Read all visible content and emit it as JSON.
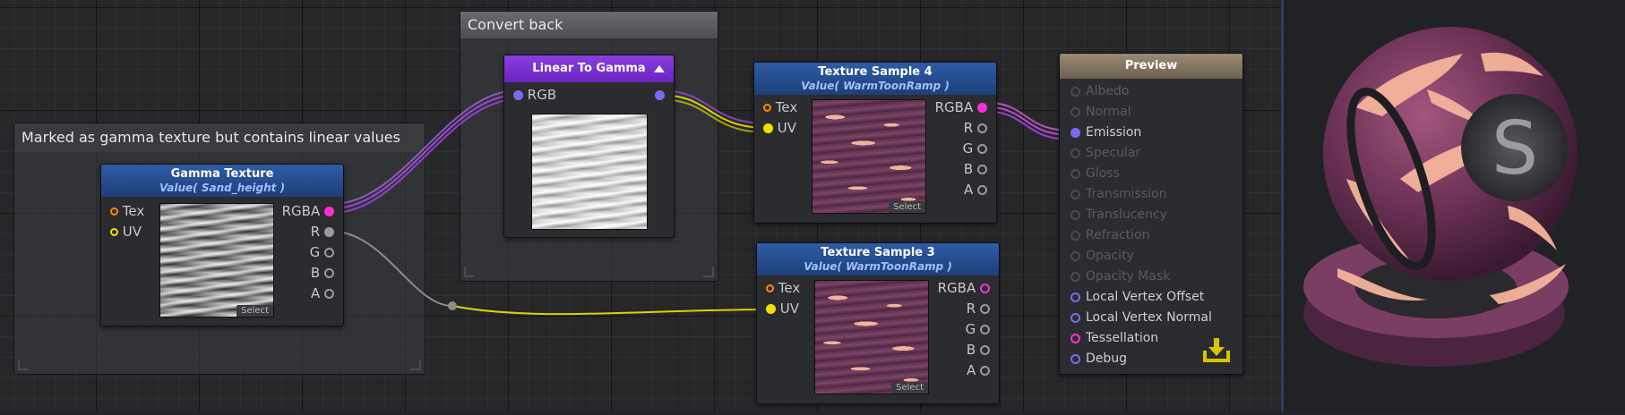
{
  "colors": {
    "rgba_port": "#ff2fd2",
    "uv_port": "#f0e000",
    "tex_port": "#ff8a00",
    "vec_port": "#7a6cf0",
    "gray_port": "#9a9a9a",
    "wire_yellow": "#d8d400",
    "wire_purple": "#9d47e0",
    "wire_magenta": "#c843d8",
    "linear_to_gamma_header": "#7a2fd0",
    "preview_header": "#8a7a66"
  },
  "groups": {
    "marked": {
      "title": "Marked as gamma texture but contains linear values"
    },
    "convert": {
      "title": "Convert back"
    }
  },
  "gamma_texture": {
    "title": "Gamma Texture",
    "subtitle": "Value( Sand_height )",
    "inputs": [
      "Tex",
      "UV"
    ],
    "outputs": [
      "RGBA",
      "R",
      "G",
      "B",
      "A"
    ],
    "select": "Select"
  },
  "linear_to_gamma": {
    "title": "Linear To Gamma",
    "toggle_icon": "triangle-up-icon",
    "input": "RGB"
  },
  "texture_sample_4": {
    "title": "Texture Sample 4",
    "subtitle": "Value( WarmToonRamp )",
    "inputs": [
      "Tex",
      "UV"
    ],
    "outputs": [
      "RGBA",
      "R",
      "G",
      "B",
      "A"
    ],
    "select": "Select"
  },
  "texture_sample_3": {
    "title": "Texture Sample 3",
    "subtitle": "Value( WarmToonRamp )",
    "inputs": [
      "Tex",
      "UV"
    ],
    "outputs": [
      "RGBA",
      "R",
      "G",
      "B",
      "A"
    ],
    "select": "Select"
  },
  "preview_node": {
    "title": "Preview",
    "inputs": [
      {
        "label": "Albedo",
        "active": false
      },
      {
        "label": "Normal",
        "active": false
      },
      {
        "label": "Emission",
        "active": true,
        "connected": true
      },
      {
        "label": "Specular",
        "active": false
      },
      {
        "label": "Gloss",
        "active": false
      },
      {
        "label": "Transmission",
        "active": false
      },
      {
        "label": "Translucency",
        "active": false
      },
      {
        "label": "Refraction",
        "active": false
      },
      {
        "label": "Opacity",
        "active": false
      },
      {
        "label": "Opacity Mask",
        "active": false
      },
      {
        "label": "Local Vertex Offset",
        "active": true
      },
      {
        "label": "Local Vertex Normal",
        "active": true
      },
      {
        "label": "Tessellation",
        "active": true,
        "magenta": true
      },
      {
        "label": "Debug",
        "active": true
      }
    ],
    "export_icon": "download-tray-icon"
  },
  "preview_sphere": {
    "logo_letter": "S"
  }
}
